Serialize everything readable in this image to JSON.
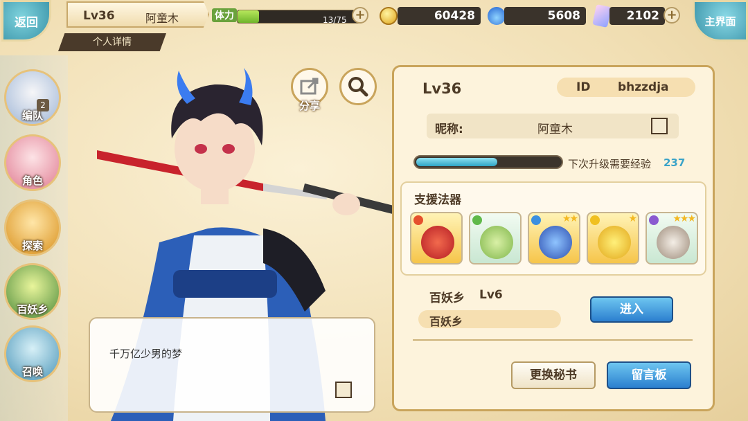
{
  "topbar": {
    "back_label": "返回",
    "home_label": "主界面",
    "level": "Lv36",
    "player_name": "阿童木",
    "detail_tab": "个人详情",
    "stamina": {
      "label": "体力",
      "text": "13/75",
      "current": 13,
      "max": 75
    },
    "gold": "60428",
    "blue_currency": "5608",
    "crystal": "2102"
  },
  "nav": {
    "items": [
      {
        "label": "编队",
        "badge": "2"
      },
      {
        "label": "角色"
      },
      {
        "label": "探索"
      },
      {
        "label": "百妖乡"
      },
      {
        "label": "召唤"
      }
    ]
  },
  "actions": {
    "share_label": "分享"
  },
  "speech": {
    "text": "千万亿少男的梦"
  },
  "profile": {
    "level": "Lv36",
    "id_label": "ID",
    "id_value": "bhzzdja",
    "nickname_label": "昵称:",
    "nickname_value": "阿童木",
    "exp_label": "下次升级需要经验",
    "exp_value": "237",
    "exp_progress": 0.55
  },
  "support": {
    "title": "支援法器",
    "cards": [
      {
        "element": "fire",
        "stars": "",
        "rarity": "gold"
      },
      {
        "element": "wind",
        "stars": "",
        "rarity": "green"
      },
      {
        "element": "water",
        "stars": "★★",
        "rarity": "gold"
      },
      {
        "element": "light",
        "stars": "★",
        "rarity": "gold"
      },
      {
        "element": "dark",
        "stars": "★★★",
        "rarity": "green"
      }
    ]
  },
  "village": {
    "name": "百妖乡",
    "level": "Lv6",
    "pill": "百妖乡",
    "enter_label": "进入"
  },
  "buttons": {
    "change_secretary": "更换秘书",
    "message_board": "留言板"
  }
}
